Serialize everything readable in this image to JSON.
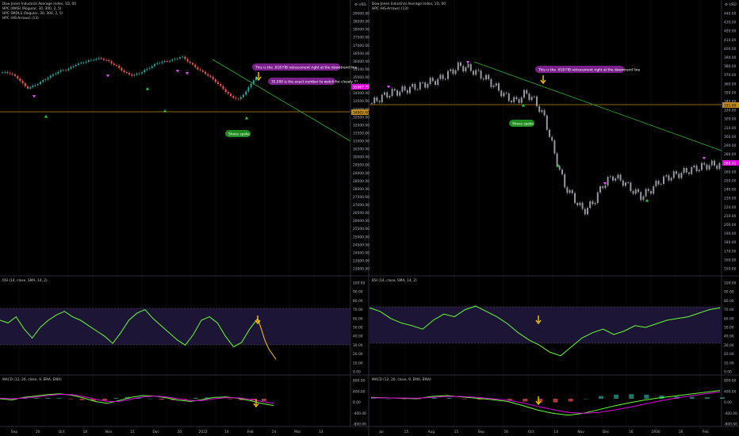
{
  "colors": {
    "background": "#000000",
    "grid": "#151515",
    "separator": "#2a2e39",
    "up_candle": "#26a69a",
    "down_candle": "#ef5350",
    "neutral_candle": "#9598a1",
    "support_line": "#c08a1e",
    "trend_line": "#2fb12f",
    "rsi_line": "#66ff33",
    "rsi_projection": "#ffc800",
    "rsi_band": "#2a1d4f",
    "macd_line": "#66ff33",
    "signal_line": "#e000e0",
    "hist_up": "#26a69a",
    "hist_down": "#ef5350",
    "buy_marker": "#2ecc40",
    "sell_marker": "#e040fb",
    "callout_purple": "#7b1f8c",
    "callout_green": "#1e8c1e",
    "arrow_yellow": "#ffc800",
    "price_tag": "#e000e0"
  },
  "left": {
    "legend": [
      "Dow Jones Industrial Average Index, 1D, 00",
      "HPC (WAS) (Regular, 30, 300, 2, 5)",
      "HPC SMDLS (Regular, 30, 300, 2, 5)",
      "HPC (HS-Arrows) (13)"
    ],
    "price_axis": {
      "ticks": [
        "39000.00",
        "38500.00",
        "38000.00",
        "37500.00",
        "37000.00",
        "36500.00",
        "36000.00",
        "35500.00",
        "35000.00",
        "34500.00",
        "34000.00",
        "33500.00",
        "33000.00",
        "32500.00",
        "32000.00",
        "31500.00",
        "31000.00",
        "30500.00",
        "30000.00",
        "29500.00",
        "29000.00",
        "28500.00",
        "28000.00",
        "27500.00",
        "27000.00",
        "26500.00",
        "26000.00",
        "25500.00",
        "25000.00",
        "24500.00",
        "24000.00",
        "23500.00",
        "23000.00"
      ],
      "last_price_tag": "35067.75",
      "support_tag": "34002.00"
    },
    "time_axis": [
      "Sep",
      "20",
      "Oct",
      "18",
      "Nov",
      "15",
      "Dec",
      "20",
      "2022",
      "14",
      "Feb",
      "14",
      "Mar",
      "14"
    ],
    "callouts": {
      "fib": "This is the .618 FIB retracement right at the downtrend line",
      "level": "35,500 is the exact number to watch for closely !!!",
      "shoes": "Shoes spoke"
    },
    "rsi": {
      "legend": "RSI (14, close, SMA, 14, 2)",
      "ticks": [
        "100.00",
        "90.00",
        "80.00",
        "70.00",
        "60.00",
        "50.00",
        "40.00",
        "30.00",
        "20.00",
        "10.00",
        "0.00"
      ]
    },
    "macd": {
      "legend": "MACD (12, 26, close, 9, EMA, EMA)",
      "ticks": [
        "800.00",
        "400.00",
        "0.00",
        "-400.00",
        "-800.00"
      ]
    }
  },
  "right": {
    "legend": [
      "Dow Jones Industrial Average Index, 1D, 00",
      "HPC (HS-Arrows) (13)"
    ],
    "price_axis": {
      "ticks": [
        "440.00",
        "430.00",
        "420.00",
        "410.00",
        "400.00",
        "390.00",
        "380.00",
        "370.00",
        "360.00",
        "350.00",
        "340.00",
        "330.00",
        "320.00",
        "310.00",
        "300.00",
        "290.00",
        "280.00",
        "270.00",
        "260.00",
        "250.00",
        "240.00",
        "230.00",
        "220.00",
        "210.00",
        "200.00",
        "190.00",
        "180.00",
        "170.00",
        "160.00",
        "150.00"
      ],
      "last_price_tag": "268.41",
      "support_tag": "331.00"
    },
    "time_axis": [
      "Jul",
      "15",
      "Aug",
      "15",
      "Sep",
      "16",
      "Oct",
      "14",
      "Nov",
      "Dec",
      "16",
      "1930",
      "16",
      "Feb"
    ],
    "callouts": {
      "fib": "This is the .618 FIB retracement right at the downtrend line",
      "shoes": "Shoes spoke"
    },
    "rsi": {
      "legend": "RSI (14, close, SMA, 14, 2)",
      "ticks": [
        "100.00",
        "90.00",
        "80.00",
        "70.00",
        "60.00",
        "50.00",
        "40.00",
        "30.00",
        "20.00",
        "10.00",
        "0.00"
      ]
    },
    "macd": {
      "legend": "MACD (12, 26, close, 9, EMA, EMA)",
      "ticks": [
        "800.00",
        "400.00",
        "0.00",
        "-400.00",
        "-800.00"
      ]
    }
  },
  "chart_data": [
    {
      "type": "line",
      "title": "Dow Jones Industrial Average Index, 1D, 00",
      "subtype": "candlestick",
      "series": [
        {
          "x": [
            0,
            5,
            10,
            15,
            20,
            25,
            30,
            35,
            40,
            45,
            50,
            55,
            60,
            65,
            70,
            75,
            80,
            85,
            90,
            95,
            100,
            105,
            110,
            115,
            120,
            125,
            130,
            135,
            140,
            145,
            150,
            155
          ],
          "values": [
            35300,
            35250,
            34900,
            34300,
            34500,
            34800,
            35100,
            35400,
            35500,
            35800,
            35950,
            36100,
            36200,
            36000,
            35700,
            35300,
            35100,
            35300,
            35600,
            35900,
            36000,
            36100,
            36300,
            35900,
            35500,
            35200,
            34800,
            34300,
            33800,
            33600,
            34200,
            35000
          ]
        }
      ],
      "support_level": 34002,
      "last_price": 35067.75
    },
    {
      "type": "line",
      "title": "Dow Jones Industrial Average Index, 1D, 00",
      "subtype": "candlestick",
      "series": [
        {
          "x": [
            0,
            5,
            10,
            15,
            20,
            25,
            30,
            35,
            40,
            45,
            50,
            55,
            60,
            65,
            70,
            75,
            80,
            85,
            90,
            95,
            100,
            105,
            110,
            115,
            120,
            125,
            130,
            135,
            140,
            145,
            150,
            155,
            160,
            165,
            170,
            175,
            180
          ],
          "values": [
            338,
            345,
            350,
            352,
            355,
            358,
            362,
            365,
            372,
            380,
            378,
            372,
            365,
            355,
            345,
            340,
            350,
            340,
            320,
            280,
            245,
            230,
            215,
            225,
            245,
            255,
            250,
            240,
            232,
            240,
            250,
            255,
            258,
            262,
            265,
            268,
            268
          ]
        }
      ],
      "support_level": 331,
      "last_price": 268.41
    },
    {
      "type": "line",
      "title": "RSI (14, close, SMA, 14, 2)",
      "ylim": [
        0,
        100
      ],
      "series": [
        {
          "values": [
            58,
            55,
            62,
            48,
            38,
            50,
            58,
            64,
            68,
            62,
            58,
            52,
            46,
            40,
            32,
            44,
            58,
            66,
            70,
            60,
            52,
            44,
            36,
            30,
            42,
            58,
            62,
            55,
            40,
            28,
            33,
            48,
            60
          ]
        },
        {
          "values": [
            72,
            68,
            60,
            55,
            52,
            48,
            58,
            65,
            62,
            70,
            74,
            68,
            62,
            54,
            44,
            36,
            30,
            22,
            18,
            28,
            38,
            44,
            48,
            42,
            46,
            52,
            50,
            54,
            58,
            60,
            62,
            66,
            70,
            72
          ]
        }
      ]
    },
    {
      "type": "line",
      "title": "MACD (12, 26, close, 9, EMA, EMA)",
      "series": [
        {
          "name": "MACD",
          "values": [
            0,
            -50,
            60,
            120,
            180,
            220,
            160,
            40,
            -120,
            -200,
            -80,
            60,
            140,
            120,
            40,
            -60,
            -120,
            -40,
            60,
            80,
            20,
            -80,
            -200,
            -300
          ]
        },
        {
          "name": "Signal",
          "values": [
            20,
            0,
            30,
            80,
            140,
            190,
            180,
            100,
            -20,
            -120,
            -120,
            -20,
            80,
            120,
            80,
            0,
            -80,
            -80,
            0,
            50,
            40,
            -20,
            -120,
            -200
          ]
        }
      ]
    }
  ]
}
